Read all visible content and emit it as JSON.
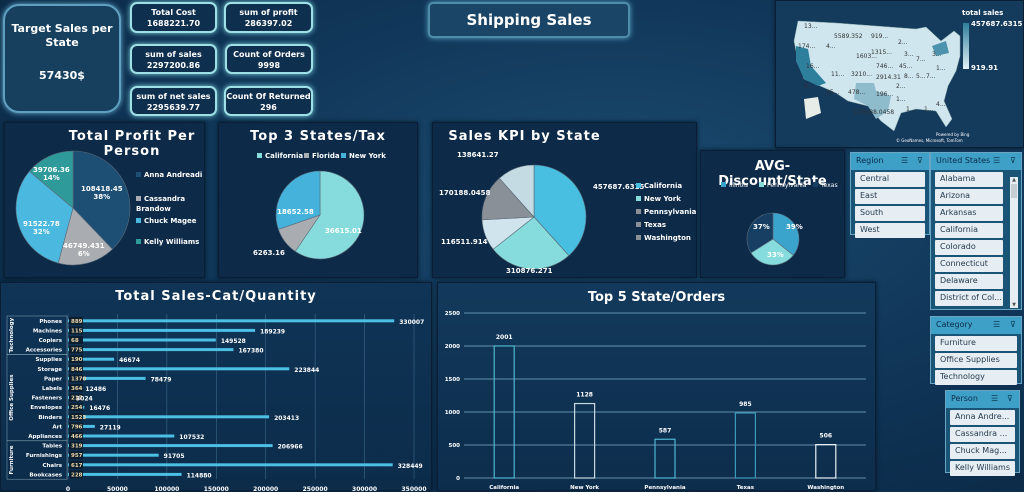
{
  "header": {
    "title": "Shipping Sales"
  },
  "target": {
    "label": "Target Sales per State",
    "value": "57430$"
  },
  "kpis": [
    {
      "label": "Total Cost",
      "value": "1688221.70"
    },
    {
      "label": "sum of profit",
      "value": "286397.02"
    },
    {
      "label": "sum of sales",
      "value": "2297200.86"
    },
    {
      "label": "Count of Orders",
      "value": "9998"
    },
    {
      "label": "sum of net sales",
      "value": "2295639.77"
    },
    {
      "label": "Count Of Returned",
      "value": "296"
    }
  ],
  "map": {
    "legend_title": "total sales",
    "max": "457687.6315",
    "min": "919.91",
    "labels": [
      "13...",
      "5589.352",
      "919...",
      "174...",
      "4...",
      "2...",
      "1603...",
      "1315...",
      "3...",
      "7...",
      "3...",
      "746...",
      "45...",
      "1...",
      "16...",
      "11...",
      "3210...",
      "2914.31",
      "8...",
      "5...",
      "7...",
      "4...",
      "2...",
      "35...",
      "478...",
      "196...",
      "1...",
      "1...",
      "1...",
      "4...",
      "170188.0458"
    ],
    "credit1": "Powered by Bing",
    "credit2": "© GeoNames, Microsoft, TomTom",
    "colors": {
      "high": "#2e7f9c",
      "low": "#e4f1f7"
    }
  },
  "slicers": {
    "region": {
      "title": "Region",
      "items": [
        "Central",
        "East",
        "South",
        "West"
      ]
    },
    "states": {
      "title": "United States",
      "items": [
        "Alabama",
        "Arizona",
        "Arkansas",
        "California",
        "Colorado",
        "Connecticut",
        "Delaware",
        "District of Col..."
      ]
    },
    "category": {
      "title": "Category",
      "items": [
        "Furniture",
        "Office Supplies",
        "Technology"
      ]
    },
    "person": {
      "title": "Person",
      "items": [
        "Anna Andre...",
        "Cassandra ...",
        "Chuck Mag...",
        "Kelly Williams"
      ]
    }
  },
  "chart_data": [
    {
      "id": "profit",
      "type": "pie",
      "title": "Total Profit Per Person",
      "categories": [
        "Anna Andreadi",
        "Cassandra Brandow",
        "Chuck Magee",
        "Kelly Williams"
      ],
      "values": [
        108418.45,
        46749.431,
        91522.78,
        39706.36
      ],
      "data_labels": [
        "108418.45\n38%",
        "46749.431\n6%",
        "91522.78\n32%",
        "39706.36\n14%"
      ],
      "colors": [
        "#1d4e74",
        "#a9adb2",
        "#4bb8e0",
        "#2f9a9a"
      ],
      "legend": "right"
    },
    {
      "id": "tax",
      "type": "pie",
      "title": "Top 3 States/Tax",
      "categories": [
        "California",
        "Florida",
        "New York"
      ],
      "values": [
        36615.01,
        6263.16,
        18652.58
      ],
      "data_labels": [
        "36615.01",
        "6263.16",
        "18652.58"
      ],
      "colors": [
        "#86dcdc",
        "#a9adb2",
        "#45b2dc"
      ],
      "legend": "top"
    },
    {
      "id": "kpi",
      "type": "pie",
      "title": "Sales KPI by State",
      "categories": [
        "California",
        "New York",
        "Pennsylvania",
        "Texas",
        "Washington"
      ],
      "values": [
        457687.6315,
        310876.271,
        116511.914,
        170188.0458,
        138641.27
      ],
      "data_labels": [
        "457687.6315",
        "310876.271",
        "116511.914",
        "170188.0458",
        "138641.27"
      ],
      "colors": [
        "#48bfe0",
        "#86dcdc",
        "#cfe4ec",
        "#8a9098",
        "#c4dbe4"
      ],
      "legend": "right"
    },
    {
      "id": "disc",
      "type": "pie",
      "title": "AVG-Discount/State",
      "categories": [
        "Illinois",
        "Pennsylvania",
        "Texas"
      ],
      "values": [
        39,
        33,
        37
      ],
      "data_labels": [
        "39%",
        "33%",
        "37%"
      ],
      "colors": [
        "#3aa4cc",
        "#86dcdc",
        "#173f63"
      ],
      "legend": "top"
    },
    {
      "id": "catqty",
      "type": "bar",
      "orientation": "horizontal",
      "title": "Total Sales-Cat/Quantity",
      "groups": [
        {
          "name": "Technology",
          "count": 4
        },
        {
          "name": "Office Supplies",
          "count": 9
        },
        {
          "name": "Furniture",
          "count": 4
        }
      ],
      "categories": [
        "Phones",
        "Machines",
        "Copiers",
        "Accessories",
        "Supplies",
        "Storage",
        "Paper",
        "Labels",
        "Fasteners",
        "Envelopes",
        "Binders",
        "Art",
        "Appliances",
        "Tables",
        "Furnishings",
        "Chairs",
        "Bookcases"
      ],
      "quantity": [
        889,
        115,
        68,
        775,
        190,
        846,
        1370,
        364,
        217,
        254,
        1523,
        796,
        466,
        319,
        957,
        617,
        228
      ],
      "values": [
        330007,
        189239,
        149528,
        167380,
        46674,
        223844,
        78479,
        12486,
        3024,
        16476,
        203413,
        27119,
        107532,
        206966,
        91705,
        328449,
        114880
      ],
      "xlim": [
        0,
        350000
      ],
      "xticks": [
        0,
        50000,
        100000,
        150000,
        200000,
        250000,
        300000,
        350000
      ],
      "grid": true,
      "color": "#4cc0e4"
    },
    {
      "id": "orders",
      "type": "bar",
      "title": "Top 5 State/Orders",
      "categories": [
        "California",
        "New York",
        "Pennsylvania",
        "Texas",
        "Washington"
      ],
      "values": [
        2001,
        1128,
        587,
        985,
        506
      ],
      "ylim": [
        0,
        2500
      ],
      "yticks": [
        0,
        500,
        1000,
        1500,
        2000,
        2500
      ],
      "grid": true,
      "colors": [
        "#4cb8d0",
        "#c8d8e0",
        "#4cb8d0",
        "#3a9ab8",
        "#e8f0f4"
      ]
    }
  ]
}
